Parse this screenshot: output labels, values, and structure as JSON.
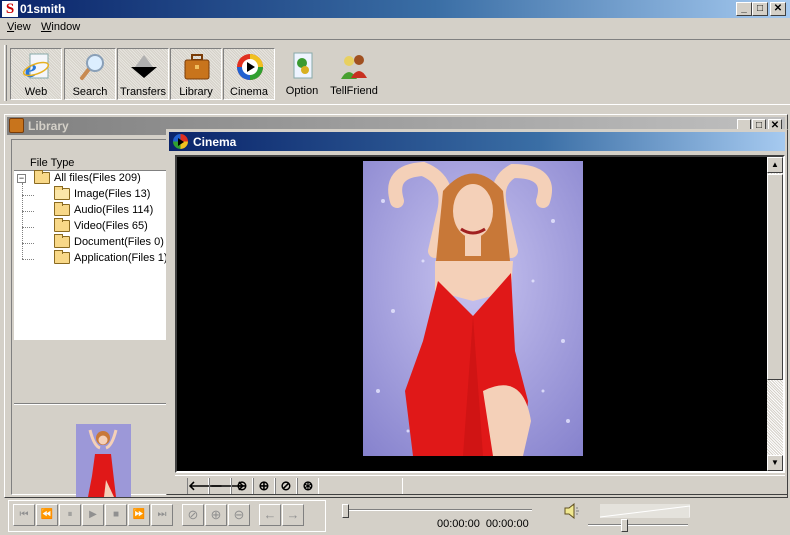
{
  "app": {
    "title": "01smith",
    "logo_letter": "S",
    "window_controls": {
      "minimize": "_",
      "maximize": "□",
      "close": "✕"
    }
  },
  "menu": [
    {
      "label": "View",
      "accel": "V"
    },
    {
      "label": "Window",
      "accel": "W"
    }
  ],
  "toolbar": [
    {
      "label": "Web",
      "icon": "internet-explorer-icon",
      "pressed": true
    },
    {
      "label": "Search",
      "icon": "magnifier-icon",
      "pressed": true
    },
    {
      "label": "Transfers",
      "icon": "transfer-arrow-icon",
      "pressed": true
    },
    {
      "label": "Library",
      "icon": "briefcase-icon",
      "pressed": true
    },
    {
      "label": "Cinema",
      "icon": "media-player-icon",
      "pressed": true
    },
    {
      "label": "Option",
      "icon": "settings-document-icon",
      "pressed": false
    },
    {
      "label": "TellFriend",
      "icon": "people-icon",
      "pressed": false
    }
  ],
  "library": {
    "title": "Library",
    "window_controls": {
      "minimize": "_",
      "maximize": "□",
      "close": "✕"
    },
    "tree_header": "File Type",
    "root": {
      "label": "All files(Files 209)",
      "expander": "−"
    },
    "children": [
      {
        "label": "Image(Files 13)",
        "open": true
      },
      {
        "label": "Audio(Files 114)",
        "open": false
      },
      {
        "label": "Video(Files 65)",
        "open": false
      },
      {
        "label": "Document(Files 0)",
        "open": false
      },
      {
        "label": "Application(Files 1)",
        "open": false
      }
    ]
  },
  "cinema": {
    "title": "Cinema",
    "image_toolbar": [
      {
        "name": "previous-image-button",
        "glyph": "🡐"
      },
      {
        "name": "next-image-button",
        "glyph": "🡒"
      },
      {
        "name": "zoom-out-button",
        "glyph": "⊖"
      },
      {
        "name": "zoom-in-button",
        "glyph": "⊕"
      },
      {
        "name": "actual-size-button",
        "glyph": "⊘"
      },
      {
        "name": "fit-button",
        "glyph": "⊛"
      }
    ],
    "scroll": {
      "up": "▲",
      "down": "▼"
    }
  },
  "player": {
    "controls": [
      {
        "name": "first-track-button",
        "glyph": "⏮"
      },
      {
        "name": "rewind-button",
        "glyph": "⏪"
      },
      {
        "name": "pause-button",
        "glyph": "⏸"
      },
      {
        "name": "play-button",
        "glyph": "▶"
      },
      {
        "name": "stop-button",
        "glyph": "■"
      },
      {
        "name": "fast-forward-button",
        "glyph": "⏩"
      },
      {
        "name": "last-track-button",
        "glyph": "⏭"
      },
      {
        "name": "actual-size-button",
        "glyph": "⊘"
      },
      {
        "name": "zoom-in-button",
        "glyph": "⊕"
      },
      {
        "name": "zoom-out-button",
        "glyph": "⊖"
      },
      {
        "name": "previous-button",
        "glyph": "←"
      },
      {
        "name": "next-button",
        "glyph": "→"
      }
    ],
    "elapsed": "00:00:00",
    "total": "00:00:00",
    "seek_position": 0,
    "volume": 0.35
  }
}
